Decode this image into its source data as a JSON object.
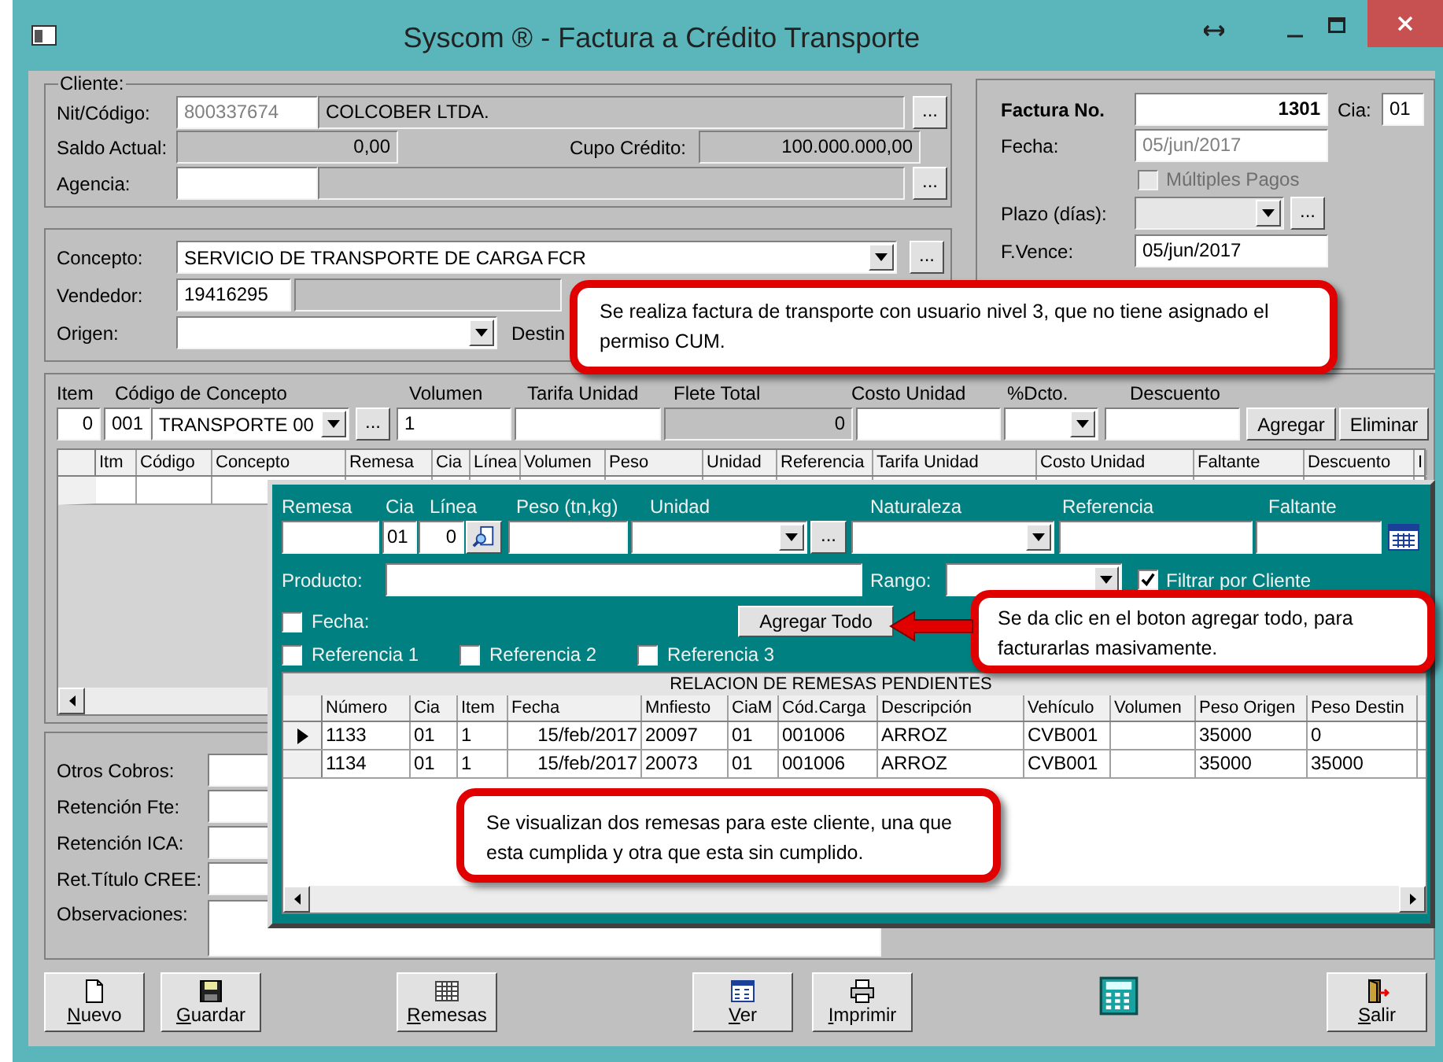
{
  "window": {
    "title": "Syscom ® - Factura a Crédito Transporte"
  },
  "cliente": {
    "legend": "Cliente:",
    "nit_label": "Nit/Código:",
    "nit": "800337674",
    "nombre": "COLCOBER LTDA.",
    "browse": "...",
    "saldo_label": "Saldo Actual:",
    "saldo": "0,00",
    "cupo_label": "Cupo Crédito:",
    "cupo": "100.000.000,00",
    "agencia_label": "Agencia:",
    "agencia_browse": "..."
  },
  "factura": {
    "label": "Factura No.",
    "numero": "1301",
    "cia_label": "Cia:",
    "cia": "01",
    "fecha_label": "Fecha:",
    "fecha": "05/jun/2017",
    "multiples_pagos": {
      "label": "Múltiples Pagos",
      "checked": false,
      "disabled": true
    },
    "plazo_label": "Plazo (días):",
    "plazo_browse": "...",
    "vence_label": "F.Vence:",
    "vence": "05/jun/2017"
  },
  "concepto": {
    "concepto_label": "Concepto:",
    "concepto": "SERVICIO DE TRANSPORTE DE CARGA  FCR",
    "browse": "...",
    "vendedor_label": "Vendedor:",
    "vendedor": "19416295",
    "origen_label": "Origen:",
    "destino_label": "Destin"
  },
  "item_entry": {
    "labels": [
      "Item",
      "Código de Concepto",
      "Volumen",
      "Tarifa Unidad",
      "Flete Total",
      "Costo Unidad",
      "%Dcto.",
      "Descuento"
    ],
    "item": "0",
    "codigo": "001",
    "concepto": "TRANSPORTE  00",
    "browse": "...",
    "volumen": "1",
    "flete": "0",
    "buttons": [
      "Agregar",
      "Eliminar"
    ]
  },
  "items_table": {
    "columns": [
      "Itm",
      "Código",
      "Concepto",
      "Remesa",
      "Cia",
      "Línea",
      "Volumen",
      "Peso",
      "Unidad",
      "Referencia",
      "Tarifa Unidad",
      "Costo Unidad",
      "Faltante",
      "Descuento",
      "I"
    ]
  },
  "retenciones": {
    "labels": [
      "Otros Cobros:",
      "Retención Fte:",
      "Retención ICA:",
      "Ret.Título CREE:"
    ],
    "observaciones_label": "Observaciones:"
  },
  "remesas_panel": {
    "labels": [
      "Remesa",
      "Cia",
      "Línea",
      "Peso (tn,kg)",
      "Unidad",
      "Naturaleza",
      "Referencia",
      "Faltante"
    ],
    "cia": "01",
    "linea": "0",
    "unidad_browse": "...",
    "producto_label": "Producto:",
    "rango_label": "Rango:",
    "filtrar": {
      "label": "Filtrar por Cliente",
      "checked": true
    },
    "fecha": {
      "label": "Fecha:",
      "checked": false
    },
    "agregar_todo": "Agregar Todo",
    "referencias": [
      {
        "label": "Referencia 1",
        "checked": false
      },
      {
        "label": "Referencia 2",
        "checked": false
      },
      {
        "label": "Referencia 3",
        "checked": false
      }
    ],
    "table": {
      "title": "RELACION DE REMESAS PENDIENTES",
      "columns": [
        "Número",
        "Cia",
        "Item",
        "Fecha",
        "Mnfiesto",
        "CiaM",
        "Cód.Carga",
        "Descripción",
        "Vehículo",
        "Volumen",
        "Peso Origen",
        "Peso Destin"
      ],
      "rows": [
        {
          "selected": true,
          "cells": [
            "1133",
            "01",
            "1",
            "15/feb/2017",
            "20097",
            "01",
            "001006",
            "ARROZ",
            "CVB001",
            "",
            "35000",
            "0"
          ]
        },
        {
          "selected": false,
          "cells": [
            "1134",
            "01",
            "1",
            "15/feb/2017",
            "20073",
            "01",
            "001006",
            "ARROZ",
            "CVB001",
            "",
            "35000",
            "35000"
          ]
        }
      ]
    }
  },
  "notes": [
    "Se realiza factura de transporte con usuario nivel 3, que no tiene asignado el permiso CUM.",
    "Se da clic en el boton agregar todo, para facturarlas masivamente.",
    "Se visualizan dos remesas para este cliente, una que esta cumplida y otra que esta sin cumplido."
  ],
  "toolbar": [
    {
      "label": "Nuevo",
      "kind": "new"
    },
    {
      "label": "Guardar",
      "kind": "save"
    },
    {
      "label": "Remesas",
      "kind": "grid"
    },
    {
      "label": "Ver",
      "kind": "view"
    },
    {
      "label": "Imprimir",
      "kind": "print"
    },
    {
      "kind": "calculator"
    },
    {
      "label": "Salir",
      "kind": "exit"
    }
  ]
}
